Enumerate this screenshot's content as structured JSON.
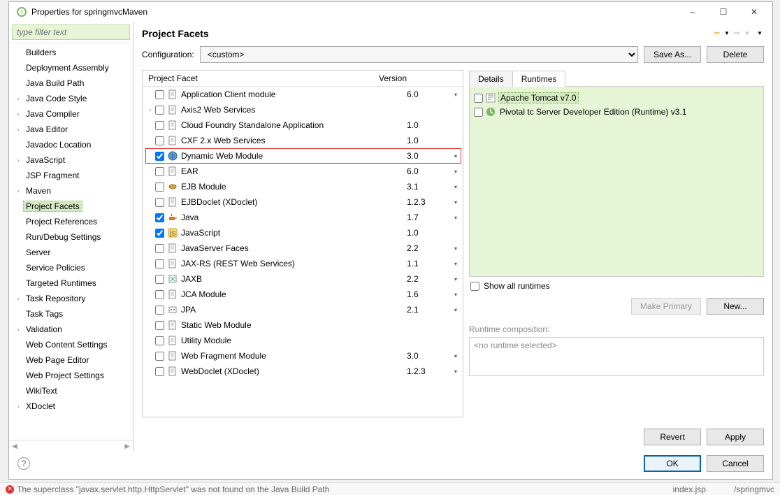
{
  "window": {
    "title": "Properties for springmvcMaven",
    "min_icon": "–",
    "max_icon": "☐",
    "close_icon": "✕"
  },
  "sidebar": {
    "filter_placeholder": "type filter text",
    "items": [
      {
        "label": "Builders",
        "expander": ""
      },
      {
        "label": "Deployment Assembly",
        "expander": ""
      },
      {
        "label": "Java Build Path",
        "expander": ""
      },
      {
        "label": "Java Code Style",
        "expander": "›"
      },
      {
        "label": "Java Compiler",
        "expander": "›"
      },
      {
        "label": "Java Editor",
        "expander": "›"
      },
      {
        "label": "Javadoc Location",
        "expander": ""
      },
      {
        "label": "JavaScript",
        "expander": "›"
      },
      {
        "label": "JSP Fragment",
        "expander": ""
      },
      {
        "label": "Maven",
        "expander": "›"
      },
      {
        "label": "Project Facets",
        "expander": "",
        "selected": true
      },
      {
        "label": "Project References",
        "expander": ""
      },
      {
        "label": "Run/Debug Settings",
        "expander": ""
      },
      {
        "label": "Server",
        "expander": ""
      },
      {
        "label": "Service Policies",
        "expander": ""
      },
      {
        "label": "Targeted Runtimes",
        "expander": ""
      },
      {
        "label": "Task Repository",
        "expander": "›"
      },
      {
        "label": "Task Tags",
        "expander": ""
      },
      {
        "label": "Validation",
        "expander": "›"
      },
      {
        "label": "Web Content Settings",
        "expander": ""
      },
      {
        "label": "Web Page Editor",
        "expander": ""
      },
      {
        "label": "Web Project Settings",
        "expander": ""
      },
      {
        "label": "WikiText",
        "expander": ""
      },
      {
        "label": "XDoclet",
        "expander": "›"
      }
    ]
  },
  "content": {
    "heading": "Project Facets",
    "config_label": "Configuration:",
    "config_selected": "<custom>",
    "save_as": "Save As...",
    "delete": "Delete",
    "col_facet": "Project Facet",
    "col_version": "Version"
  },
  "facets": [
    {
      "name": "Application Client module",
      "version": "6.0",
      "checked": false,
      "caret": true,
      "icon": "doc"
    },
    {
      "name": "Axis2 Web Services",
      "version": "",
      "checked": false,
      "caret": false,
      "icon": "doc",
      "expander": "›"
    },
    {
      "name": "Cloud Foundry Standalone Application",
      "version": "1.0",
      "checked": false,
      "caret": false,
      "icon": "doc"
    },
    {
      "name": "CXF 2.x Web Services",
      "version": "1.0",
      "checked": false,
      "caret": false,
      "icon": "doc"
    },
    {
      "name": "Dynamic Web Module",
      "version": "3.0",
      "checked": true,
      "caret": true,
      "icon": "globe",
      "highlight": true
    },
    {
      "name": "EAR",
      "version": "6.0",
      "checked": false,
      "caret": true,
      "icon": "doc"
    },
    {
      "name": "EJB Module",
      "version": "3.1",
      "checked": false,
      "caret": true,
      "icon": "bean"
    },
    {
      "name": "EJBDoclet (XDoclet)",
      "version": "1.2.3",
      "checked": false,
      "caret": true,
      "icon": "doc"
    },
    {
      "name": "Java",
      "version": "1.7",
      "checked": true,
      "caret": true,
      "icon": "java"
    },
    {
      "name": "JavaScript",
      "version": "1.0",
      "checked": true,
      "caret": false,
      "icon": "js"
    },
    {
      "name": "JavaServer Faces",
      "version": "2.2",
      "checked": false,
      "caret": true,
      "icon": "doc"
    },
    {
      "name": "JAX-RS (REST Web Services)",
      "version": "1.1",
      "checked": false,
      "caret": true,
      "icon": "doc"
    },
    {
      "name": "JAXB",
      "version": "2.2",
      "checked": false,
      "caret": true,
      "icon": "jaxb"
    },
    {
      "name": "JCA Module",
      "version": "1.6",
      "checked": false,
      "caret": true,
      "icon": "doc"
    },
    {
      "name": "JPA",
      "version": "2.1",
      "checked": false,
      "caret": true,
      "icon": "jpa"
    },
    {
      "name": "Static Web Module",
      "version": "",
      "checked": false,
      "caret": false,
      "icon": "doc"
    },
    {
      "name": "Utility Module",
      "version": "",
      "checked": false,
      "caret": false,
      "icon": "doc"
    },
    {
      "name": "Web Fragment Module",
      "version": "3.0",
      "checked": false,
      "caret": true,
      "icon": "doc"
    },
    {
      "name": "WebDoclet (XDoclet)",
      "version": "1.2.3",
      "checked": false,
      "caret": true,
      "icon": "doc"
    }
  ],
  "runtime_panel": {
    "tab_details": "Details",
    "tab_runtimes": "Runtimes",
    "runtimes": [
      {
        "name": "Apache Tomcat v7.0",
        "checked": false,
        "selected": true,
        "icon": "tomcat"
      },
      {
        "name": "Pivotal tc Server Developer Edition (Runtime) v3.1",
        "checked": false,
        "selected": false,
        "icon": "pivotal"
      }
    ],
    "show_all": "Show all runtimes",
    "make_primary": "Make Primary",
    "new": "New...",
    "comp_label": "Runtime composition:",
    "comp_empty": "<no runtime selected>"
  },
  "bottom": {
    "revert": "Revert",
    "apply": "Apply"
  },
  "footer": {
    "ok": "OK",
    "cancel": "Cancel"
  },
  "statusbar": {
    "error": "The superclass \"javax.servlet.http.HttpServlet\" was not found on the Java Build Path",
    "file": "index.jsp",
    "path": "/springmvc"
  }
}
